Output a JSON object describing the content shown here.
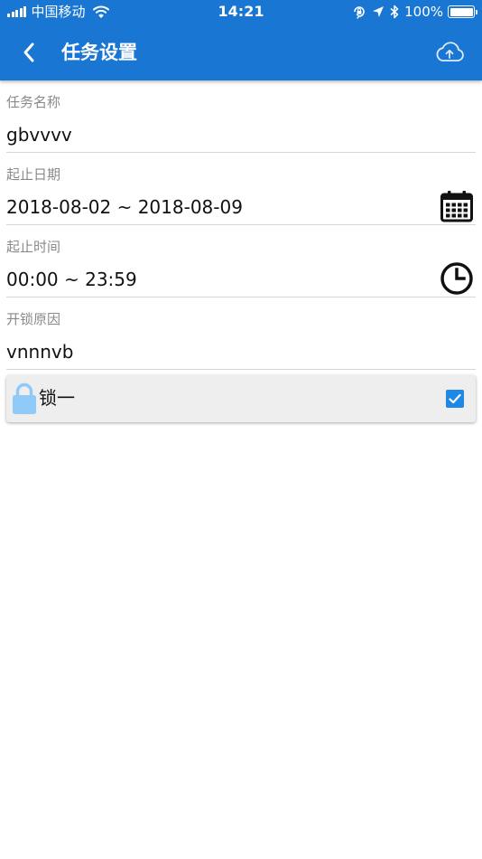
{
  "status_bar": {
    "carrier": "中国移动",
    "time": "14:21",
    "battery": "100%",
    "icons": [
      "signal-icon",
      "wifi-icon",
      "orientation-lock-icon",
      "location-icon",
      "bluetooth-icon",
      "battery-icon"
    ]
  },
  "header": {
    "title": "任务设置",
    "back_icon": "chevron-left-icon",
    "upload_icon": "cloud-upload-icon"
  },
  "form": {
    "task_name": {
      "label": "任务名称",
      "value": "gbvvvv"
    },
    "date_range": {
      "label": "起止日期",
      "value": "2018-08-02 ~ 2018-08-09",
      "icon": "calendar-icon"
    },
    "time_range": {
      "label": "起止时间",
      "value": "00:00 ~ 23:59",
      "icon": "clock-icon"
    },
    "reason": {
      "label": "开锁原因",
      "value": "vnnnvb"
    }
  },
  "locks": [
    {
      "name": "锁一",
      "checked": true,
      "icon": "lock-icon"
    }
  ],
  "colors": {
    "primary": "#1976d2",
    "checkbox": "#1e88e5",
    "lock_icon": "#90caf9",
    "label": "#8a8a8a",
    "divider": "#d6d6d6",
    "card_bg": "#eeeeee"
  }
}
